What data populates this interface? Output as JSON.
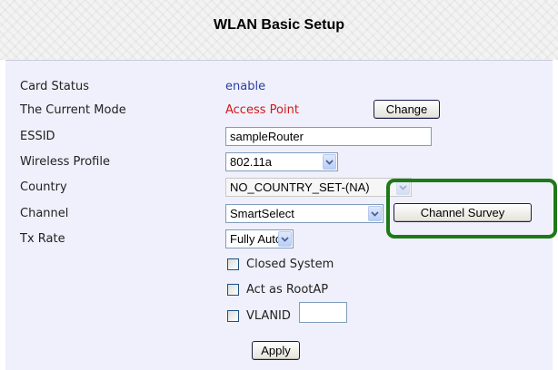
{
  "page": {
    "title": "WLAN Basic Setup"
  },
  "form": {
    "card_status": {
      "label": "Card Status",
      "value": "enable"
    },
    "current_mode": {
      "label": "The Current Mode",
      "value": "Access Point",
      "button": "Change"
    },
    "essid": {
      "label": "ESSID",
      "value": "sampleRouter"
    },
    "wireless_profile": {
      "label": "Wireless Profile",
      "selected": "802.11a"
    },
    "country": {
      "label": "Country",
      "selected": "NO_COUNTRY_SET-(NA)",
      "disabled": true
    },
    "channel": {
      "label": "Channel",
      "selected": "SmartSelect",
      "button": "Channel Survey"
    },
    "tx_rate": {
      "label": "Tx Rate",
      "selected": "Fully Auto"
    },
    "checkboxes": [
      {
        "label": "Closed System",
        "checked": false
      },
      {
        "label": "Act as RootAP",
        "checked": false
      },
      {
        "label": "VLANID",
        "checked": false
      }
    ],
    "vlanid_value": "",
    "apply_button": "Apply"
  },
  "colors": {
    "panel_bg": "#eff0fb",
    "status_value": "#2a3fa0",
    "mode_value": "#d01818",
    "highlight_border": "#1c7a18"
  },
  "icons": {
    "dropdown_arrow": "chevron-down-icon"
  }
}
